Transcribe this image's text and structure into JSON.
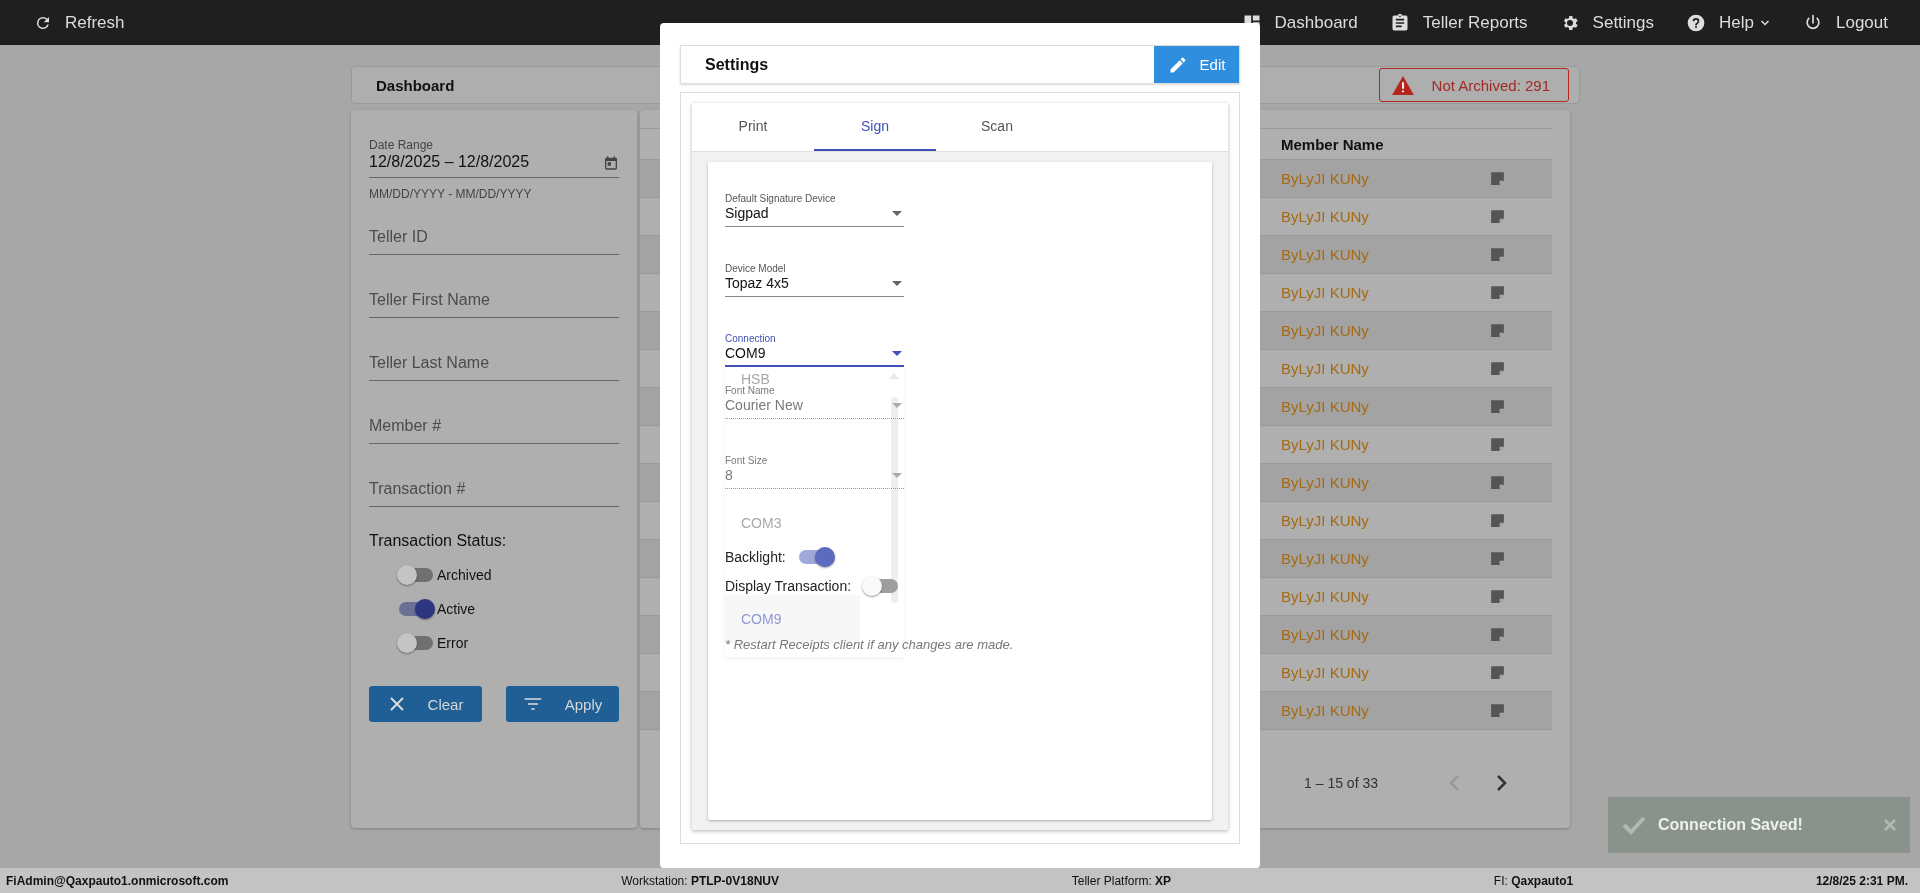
{
  "top_bar": {
    "refresh": {
      "label": "Refresh"
    },
    "nav": [
      {
        "label": "Dashboard",
        "dropdown": false
      },
      {
        "label": "Teller Reports",
        "dropdown": false
      },
      {
        "label": "Settings",
        "dropdown": false
      },
      {
        "label": "Help",
        "dropdown": true
      },
      {
        "label": "Logout",
        "dropdown": false
      }
    ]
  },
  "dashboard": {
    "title": "Dashboard",
    "alert": "Not Archived: 291"
  },
  "filters": {
    "date_range": {
      "label": "Date Range",
      "value": "12/8/2025 – 12/8/2025",
      "hint": "MM/DD/YYYY - MM/DD/YYYY"
    },
    "fields": [
      {
        "placeholder": "Teller ID"
      },
      {
        "placeholder": "Teller First Name"
      },
      {
        "placeholder": "Teller Last Name"
      },
      {
        "placeholder": "Member #"
      },
      {
        "placeholder": "Transaction #"
      }
    ],
    "status_label": "Transaction Status:",
    "statuses": [
      {
        "label": "Archived",
        "on": false
      },
      {
        "label": "Active",
        "on": true
      },
      {
        "label": "Error",
        "on": false
      }
    ],
    "buttons": [
      {
        "label": "Clear",
        "kind": "clear"
      },
      {
        "label": "Apply",
        "kind": "apply"
      }
    ]
  },
  "table": {
    "columns": [
      "Member Name"
    ],
    "rows": [
      {
        "member_name": "ByLyJI KUNy"
      },
      {
        "member_name": "ByLyJI KUNy"
      },
      {
        "member_name": "ByLyJI KUNy"
      },
      {
        "member_name": "ByLyJI KUNy"
      },
      {
        "member_name": "ByLyJI KUNy"
      },
      {
        "member_name": "ByLyJI KUNy"
      },
      {
        "member_name": "ByLyJI KUNy"
      },
      {
        "member_name": "ByLyJI KUNy"
      },
      {
        "member_name": "ByLyJI KUNy"
      },
      {
        "member_name": "ByLyJI KUNy"
      },
      {
        "member_name": "ByLyJI KUNy"
      },
      {
        "member_name": "ByLyJI KUNy"
      },
      {
        "member_name": "ByLyJI KUNy"
      },
      {
        "member_name": "ByLyJI KUNy"
      },
      {
        "member_name": "ByLyJI KUNy"
      }
    ],
    "pagination": {
      "range": "1 – 15 of 33",
      "prev": {
        "disabled": true
      },
      "next": {
        "disabled": false
      }
    }
  },
  "settings_dialog": {
    "title": "Settings",
    "edit_button": "Edit",
    "tabs": [
      {
        "label": "Print",
        "selected": false
      },
      {
        "label": "Sign",
        "selected": true
      },
      {
        "label": "Scan",
        "selected": false
      }
    ],
    "fields": [
      {
        "label": "Default Signature Device",
        "value": "Sigpad",
        "focused": false,
        "disabled": false
      },
      {
        "label": "Device Model",
        "value": "Topaz 4x5",
        "focused": false,
        "disabled": false
      },
      {
        "label": "Connection",
        "value": "COM9",
        "focused": true,
        "disabled": false
      },
      {
        "label": "Font Name",
        "value": "Courier New",
        "focused": false,
        "disabled": true
      },
      {
        "label": "Font Size",
        "value": "8",
        "focused": false,
        "disabled": true
      }
    ],
    "connection_options": [
      {
        "label": "HSB",
        "selected": false
      },
      {
        "label": "COM3",
        "selected": false
      },
      {
        "label": "COM9",
        "selected": true
      }
    ],
    "toggles": [
      {
        "label": "Backlight:",
        "on": true
      },
      {
        "label": "Display Transaction:",
        "on": false
      }
    ],
    "note": "* Restart Receipts client if any changes are made."
  },
  "toast": {
    "message": "Connection Saved!"
  },
  "status_bar": [
    "**FiAdmin@Qaxpauto1.onmicrosoft.com**",
    "Workstation: **PTLP-0V18NUV**",
    "Teller Platform: **XP**",
    "FI: **Qaxpauto1**",
    "**12/8/25 2:31 PM.**"
  ]
}
